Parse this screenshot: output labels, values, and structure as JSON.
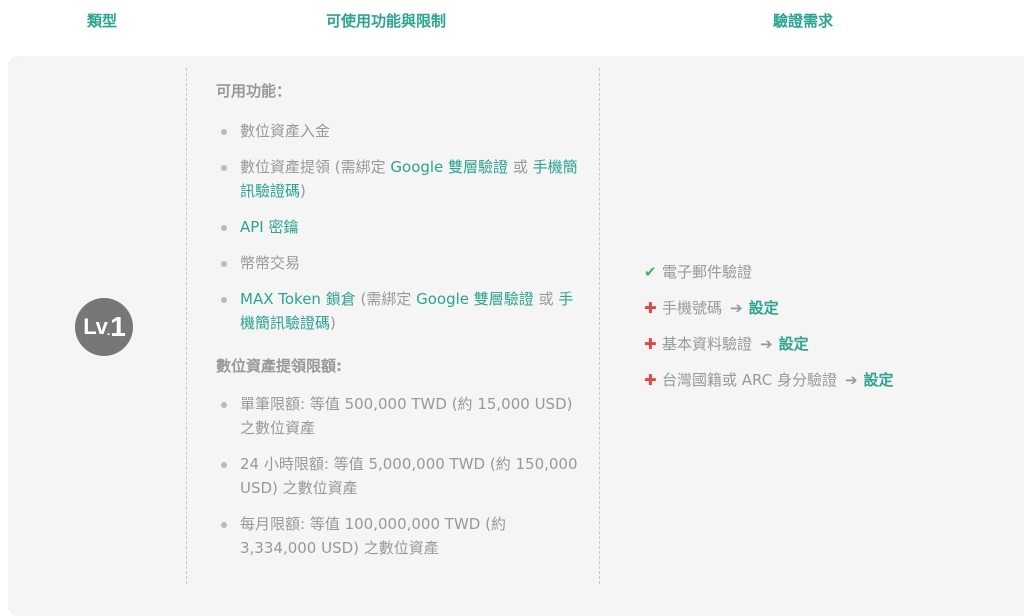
{
  "header": {
    "col_type": "類型",
    "col_features": "可使用功能與限制",
    "col_verification": "驗證需求"
  },
  "badge": {
    "lv": "Lv",
    "dot": ".",
    "num": "1"
  },
  "features": {
    "title": "可用功能：",
    "items": {
      "deposit": "數位資產入金",
      "withdraw_pre": "數位資產提領 (需綁定 ",
      "withdraw_link1": "Google 雙層驗證",
      "withdraw_mid": " 或 ",
      "withdraw_link2": "手機簡訊驗證碼",
      "withdraw_post": ")",
      "api": "API 密鑰",
      "trade": "幣幣交易",
      "lock_link": "MAX Token 鎖倉",
      "lock_pre": " (需綁定 ",
      "lock_link1": "Google 雙層驗證",
      "lock_mid": " 或 ",
      "lock_link2": "手機簡訊驗證碼",
      "lock_post": ")"
    }
  },
  "limits": {
    "title": "數位資產提領限額:",
    "items": [
      "單筆限額: 等值 500,000 TWD (約 15,000 USD) 之數位資產",
      "24 小時限額: 等值 5,000,000 TWD (約 150,000 USD) 之數位資產",
      "每月限額: 等值 100,000,000 TWD (約 3,334,000 USD) 之數位資產"
    ]
  },
  "requirements": [
    {
      "status": "done",
      "icon": "check-icon",
      "label": "電子郵件驗證",
      "action": ""
    },
    {
      "status": "todo",
      "icon": "plus-icon",
      "label": "手機號碼",
      "action": "設定"
    },
    {
      "status": "todo",
      "icon": "plus-icon",
      "label": "基本資料驗證",
      "action": "設定"
    },
    {
      "status": "todo",
      "icon": "plus-icon",
      "label": "台灣國籍或 ARC 身分驗證",
      "action": "設定"
    }
  ],
  "colors": {
    "accent": "#2aa58f",
    "check": "#3fb65d",
    "plus": "#e8433f",
    "badge": "#777777"
  }
}
